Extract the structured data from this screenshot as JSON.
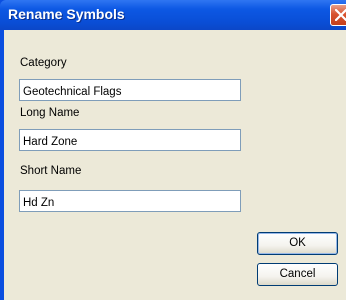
{
  "window": {
    "title": "Rename Symbols",
    "close_icon": "close-x-icon"
  },
  "form": {
    "category": {
      "label": "Category",
      "value": "Geotechnical Flags"
    },
    "long_name": {
      "label": "Long Name",
      "value": "Hard Zone"
    },
    "short_name": {
      "label": "Short Name",
      "value": "Hd Zn"
    }
  },
  "buttons": {
    "ok_label": "OK",
    "cancel_label": "Cancel"
  },
  "colors": {
    "titlebar": "#0a4fd8",
    "dialog_background": "#ece9d8",
    "close_button": "#d8532f",
    "field_border": "#7f9db9"
  }
}
